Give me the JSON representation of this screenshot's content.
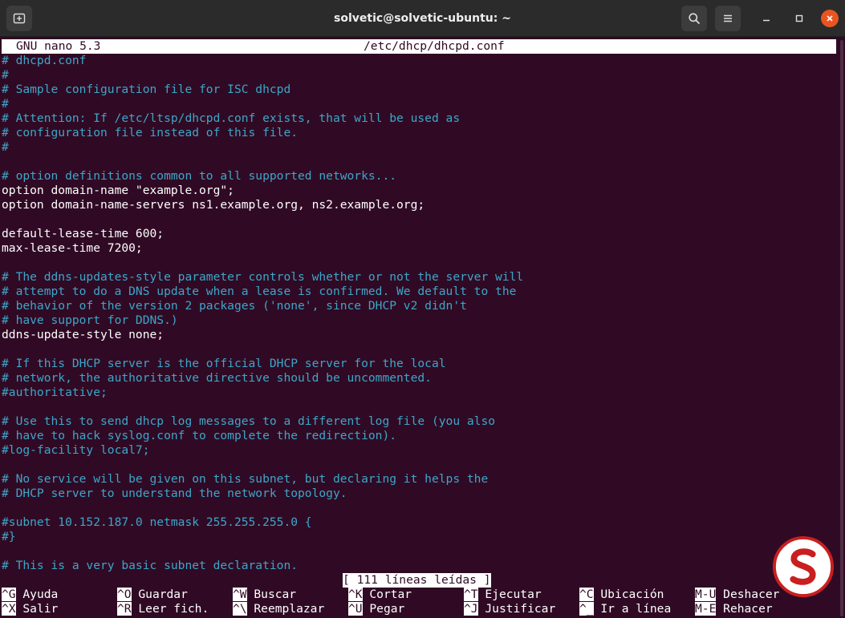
{
  "window": {
    "title": "solvetic@solvetic-ubuntu: ~",
    "accent": "#e95420",
    "terminal_bg": "#300a24",
    "comment_color": "#3da6c9"
  },
  "titlebar": {
    "new_tab_icon": "new-tab-icon",
    "search_icon": "search-icon",
    "menu_icon": "hamburger-menu-icon",
    "minimize_icon": "minimize-icon",
    "maximize_icon": "maximize-icon",
    "close_icon": "close-icon"
  },
  "nano": {
    "version": "GNU nano 5.3",
    "filename": "/etc/dhcp/dhcpd.conf",
    "lines": [
      {
        "text": "# dhcpd.conf",
        "type": "comment"
      },
      {
        "text": "#",
        "type": "comment"
      },
      {
        "text": "# Sample configuration file for ISC dhcpd",
        "type": "comment"
      },
      {
        "text": "#",
        "type": "comment"
      },
      {
        "text": "# Attention: If /etc/ltsp/dhcpd.conf exists, that will be used as",
        "type": "comment"
      },
      {
        "text": "# configuration file instead of this file.",
        "type": "comment"
      },
      {
        "text": "#",
        "type": "comment"
      },
      {
        "text": "",
        "type": "blank"
      },
      {
        "text": "# option definitions common to all supported networks...",
        "type": "comment"
      },
      {
        "text": "option domain-name \"example.org\";",
        "type": "code"
      },
      {
        "text": "option domain-name-servers ns1.example.org, ns2.example.org;",
        "type": "code"
      },
      {
        "text": "",
        "type": "blank"
      },
      {
        "text": "default-lease-time 600;",
        "type": "code"
      },
      {
        "text": "max-lease-time 7200;",
        "type": "code"
      },
      {
        "text": "",
        "type": "blank"
      },
      {
        "text": "# The ddns-updates-style parameter controls whether or not the server will",
        "type": "comment"
      },
      {
        "text": "# attempt to do a DNS update when a lease is confirmed. We default to the",
        "type": "comment"
      },
      {
        "text": "# behavior of the version 2 packages ('none', since DHCP v2 didn't",
        "type": "comment"
      },
      {
        "text": "# have support for DDNS.)",
        "type": "comment"
      },
      {
        "text": "ddns-update-style none;",
        "type": "code"
      },
      {
        "text": "",
        "type": "blank"
      },
      {
        "text": "# If this DHCP server is the official DHCP server for the local",
        "type": "comment"
      },
      {
        "text": "# network, the authoritative directive should be uncommented.",
        "type": "comment"
      },
      {
        "text": "#authoritative;",
        "type": "comment"
      },
      {
        "text": "",
        "type": "blank"
      },
      {
        "text": "# Use this to send dhcp log messages to a different log file (you also",
        "type": "comment"
      },
      {
        "text": "# have to hack syslog.conf to complete the redirection).",
        "type": "comment"
      },
      {
        "text": "#log-facility local7;",
        "type": "comment"
      },
      {
        "text": "",
        "type": "blank"
      },
      {
        "text": "# No service will be given on this subnet, but declaring it helps the",
        "type": "comment"
      },
      {
        "text": "# DHCP server to understand the network topology.",
        "type": "comment"
      },
      {
        "text": "",
        "type": "blank"
      },
      {
        "text": "#subnet 10.152.187.0 netmask 255.255.255.0 {",
        "type": "comment"
      },
      {
        "text": "#}",
        "type": "comment"
      },
      {
        "text": "",
        "type": "blank"
      },
      {
        "text": "# This is a very basic subnet declaration.",
        "type": "comment"
      }
    ],
    "status": "[ 111 líneas leídas ]",
    "shortcuts_row1": [
      {
        "key": "^G",
        "label": "Ayuda"
      },
      {
        "key": "^O",
        "label": "Guardar"
      },
      {
        "key": "^W",
        "label": "Buscar"
      },
      {
        "key": "^K",
        "label": "Cortar"
      },
      {
        "key": "^T",
        "label": "Ejecutar"
      },
      {
        "key": "^C",
        "label": "Ubicación"
      },
      {
        "key": "M-U",
        "label": "Deshacer"
      }
    ],
    "shortcuts_row2": [
      {
        "key": "^X",
        "label": "Salir"
      },
      {
        "key": "^R",
        "label": "Leer fich."
      },
      {
        "key": "^\\",
        "label": "Reemplazar"
      },
      {
        "key": "^U",
        "label": "Pegar"
      },
      {
        "key": "^J",
        "label": "Justificar"
      },
      {
        "key": "^_",
        "label": "Ir a línea"
      },
      {
        "key": "M-E",
        "label": "Rehacer"
      }
    ]
  },
  "watermark": {
    "icon": "solvetic-logo-icon"
  }
}
